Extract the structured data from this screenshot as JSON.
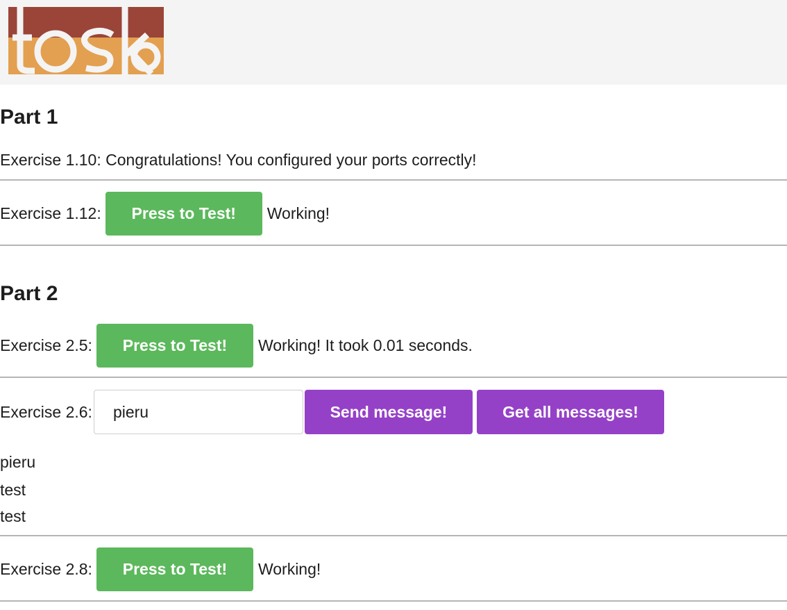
{
  "header": {
    "logo_alt": "toska"
  },
  "part1": {
    "title": "Part 1",
    "ex110": "Exercise 1.10: Congratulations! You configured your ports correctly!",
    "ex112": {
      "label": "Exercise 1.12:",
      "button": "Press to Test!",
      "status": "Working!"
    }
  },
  "part2": {
    "title": "Part 2",
    "ex25": {
      "label": "Exercise 2.5:",
      "button": "Press to Test!",
      "status": "Working! It took 0.01 seconds."
    },
    "ex26": {
      "label": "Exercise 2.6:",
      "input_value": "pieru",
      "send_button": "Send message!",
      "get_button": "Get all messages!",
      "messages": [
        "pieru",
        "test",
        "test"
      ]
    },
    "ex28": {
      "label": "Exercise 2.8:",
      "button": "Press to Test!",
      "status": "Working!"
    }
  },
  "colors": {
    "green": "#5cb85c",
    "purple": "#9541c7",
    "logo_red": "#9a4538",
    "logo_orange": "#e3a050"
  }
}
